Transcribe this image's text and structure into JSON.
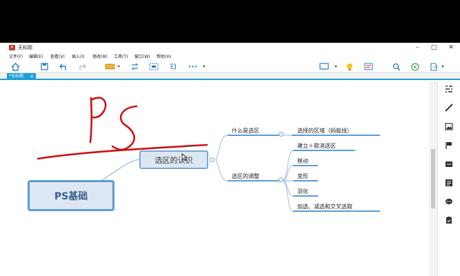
{
  "window": {
    "title": "无标题",
    "controls": {
      "minimize": "–",
      "maximize": "□",
      "close": "✕"
    }
  },
  "menu": [
    "文件(F)",
    "编辑(E)",
    "查看(V)",
    "插入(I)",
    "修改(M)",
    "工具(T)",
    "窗口(W)",
    "帮助(H)"
  ],
  "toolbar": {
    "icons": [
      "home-icon",
      "save-icon",
      "undo-icon",
      "redo-icon",
      "topic-style-icon",
      "relationship-icon",
      "boundary-icon",
      "summary-icon",
      "more-icon",
      "presentation-icon",
      "idea-icon",
      "outline-icon",
      "search-icon",
      "share-icon",
      "export-icon"
    ]
  },
  "tab": {
    "label": "*无标题",
    "close": "✕"
  },
  "mindmap": {
    "root": "PS基础",
    "main": "选区的认识",
    "branches": [
      {
        "label": "什么是选区",
        "children": [
          "选择的区域（蚂蚁线）"
        ]
      },
      {
        "label": "选区的调整",
        "children": [
          "建立＋取消选区",
          "移动",
          "变形",
          "羽化",
          "加选、减选和交叉选取"
        ]
      }
    ],
    "handwriting": "PS"
  },
  "colors": {
    "accent": "#1e9ed8",
    "node_border": "#5b9bd5",
    "node_fill": "#dde7f3",
    "ink": "#cc1111"
  }
}
